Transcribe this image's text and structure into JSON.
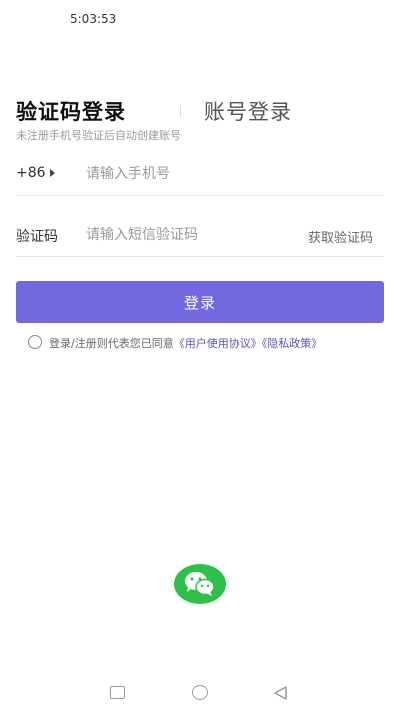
{
  "status_bar": {
    "time": "5:03:53"
  },
  "tabs": {
    "active": "验证码登录",
    "inactive": "账号登录"
  },
  "subtitle": "未注册手机号验证后自动创建账号",
  "phone": {
    "country_code": "+86",
    "placeholder": "请输入手机号",
    "value": ""
  },
  "code": {
    "label": "验证码",
    "placeholder": "请输入短信验证码",
    "value": "",
    "get_code_label": "获取验证码"
  },
  "login_button": "登录",
  "agreement": {
    "prefix": "登录/注册则代表您已同意",
    "user_agreement": "《用户使用协议》",
    "privacy_policy": "《隐私政策》",
    "checked": false
  },
  "colors": {
    "primary": "#7468df",
    "wechat": "#2dc14b",
    "link": "#5a55b8"
  },
  "icons": {
    "country_caret": "caret-right-icon",
    "wechat": "wechat-icon",
    "nav_recent": "square-icon",
    "nav_home": "circle-icon",
    "nav_back": "triangle-back-icon"
  }
}
